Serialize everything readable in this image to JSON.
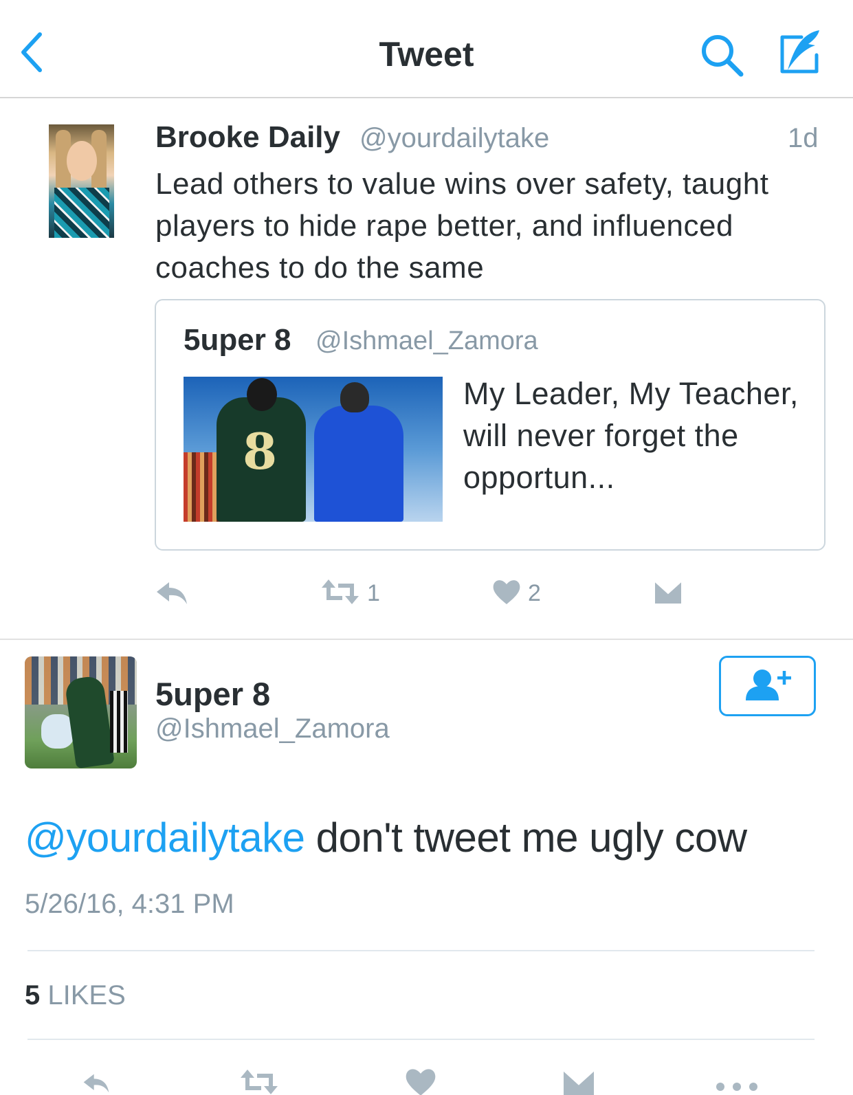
{
  "nav": {
    "title": "Tweet"
  },
  "parent_tweet": {
    "name": "Brooke Daily",
    "handle": "@yourdailytake",
    "time": "1d",
    "text": "Lead others to value wins over safety, taught players to hide rape better, and influenced coaches to do the same",
    "quote": {
      "name": "5uper 8",
      "handle": "@Ishmael_Zamora",
      "text": "My Leader, My Teacher, will never forget the opportun..."
    },
    "actions": {
      "retweet_count": "1",
      "like_count": "2"
    }
  },
  "main_tweet": {
    "name": "5uper 8",
    "handle": "@Ishmael_Zamora",
    "mention": "@yourdailytake",
    "text": " don't tweet me ugly cow",
    "timestamp": "5/26/16, 4:31 PM",
    "likes_count": "5",
    "likes_label": "LIKES"
  },
  "colors": {
    "accent": "#1da1f2",
    "secondary_text": "#8899a6",
    "icon_gray": "#aab8c2"
  },
  "icons": [
    "back-icon",
    "search-icon",
    "compose-icon",
    "reply-icon",
    "retweet-icon",
    "like-icon",
    "direct-message-icon",
    "follow-icon",
    "more-icon"
  ]
}
